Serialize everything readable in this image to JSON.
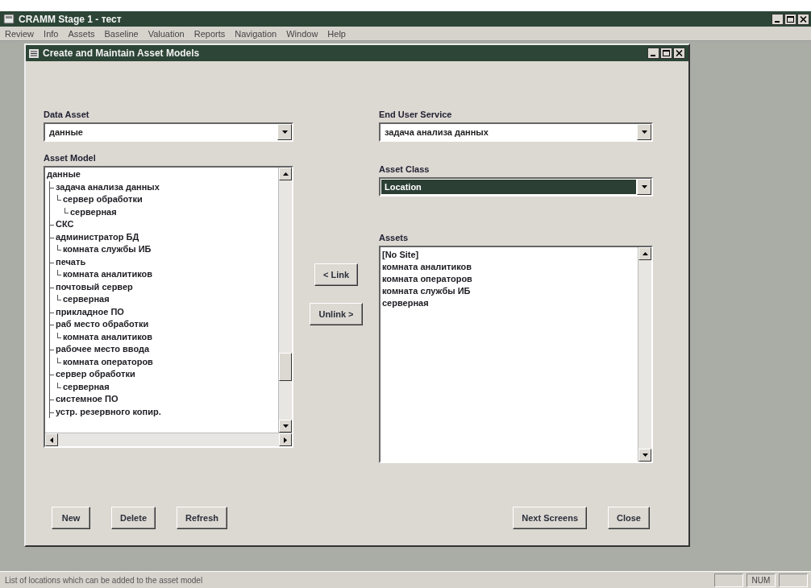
{
  "window": {
    "title": "CRAMM Stage 1 - тест"
  },
  "menu": [
    "Review",
    "Info",
    "Assets",
    "Baseline",
    "Valuation",
    "Reports",
    "Navigation",
    "Window",
    "Help"
  ],
  "dialog": {
    "title": "Create and Maintain Asset Models",
    "data_asset": {
      "label": "Data Asset",
      "value": "данные",
      "focused": false
    },
    "end_user_service": {
      "label": "End User Service",
      "value": "задача анализа данных",
      "focused": false
    },
    "asset_class": {
      "label": "Asset Class",
      "value": "Location",
      "focused": true
    },
    "asset_model": {
      "label": "Asset Model",
      "tree": [
        {
          "label": "данные",
          "children": [
            {
              "label": "задача анализа данных",
              "children": [
                {
                  "label": "сервер обработки",
                  "children": [
                    {
                      "label": "серверная"
                    }
                  ]
                }
              ]
            },
            {
              "label": "СКС"
            },
            {
              "label": "администратор БД",
              "children": [
                {
                  "label": "комната службы ИБ"
                }
              ]
            },
            {
              "label": "печать",
              "children": [
                {
                  "label": "комната аналитиков"
                }
              ]
            },
            {
              "label": "почтовый сервер",
              "children": [
                {
                  "label": "серверная"
                }
              ]
            },
            {
              "label": "прикладное ПО"
            },
            {
              "label": "раб место обработки",
              "children": [
                {
                  "label": "комната аналитиков"
                }
              ]
            },
            {
              "label": "рабочее место ввода",
              "children": [
                {
                  "label": "комната операторов"
                }
              ]
            },
            {
              "label": "сервер обработки",
              "children": [
                {
                  "label": "серверная"
                }
              ]
            },
            {
              "label": "системное ПО"
            },
            {
              "label": "устр. резервного копир."
            }
          ]
        }
      ]
    },
    "assets": {
      "label": "Assets",
      "items": [
        "[No Site]",
        "комната аналитиков",
        "комната операторов",
        "комната службы ИБ",
        "серверная"
      ]
    },
    "link_buttons": [
      "< Link",
      "Unlink >"
    ],
    "left_buttons": [
      "New",
      "Delete",
      "Refresh"
    ],
    "right_buttons": [
      "Next Screens",
      "Close"
    ]
  },
  "status_bar": {
    "text": "List of locations which can be added to the asset model",
    "num_lock": "NUM"
  }
}
